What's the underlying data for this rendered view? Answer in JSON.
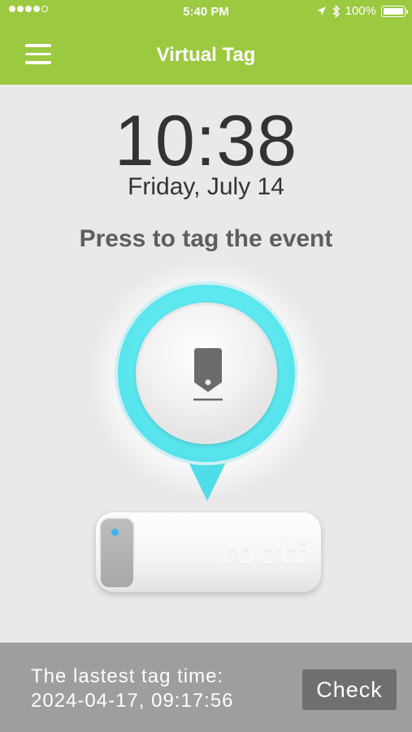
{
  "status_bar": {
    "time": "5:40 PM",
    "battery_percent": "100%",
    "signal_bars_filled": 4,
    "signal_bars_total": 5
  },
  "nav": {
    "title": "Virtual Tag",
    "menu_icon": "hamburger-menu-icon"
  },
  "clock": {
    "time": "10:38",
    "date": "Friday, July 14"
  },
  "main": {
    "prompt": "Press to tag the event",
    "tag_button_icon": "tag-icon",
    "accent_color": "#4fdde7",
    "device_brand": "rootf",
    "device_led_color": "#3fb4f0"
  },
  "footer": {
    "label": "The lastest tag time:",
    "last_tag_time": "2024-04-17, 09:17:56",
    "check_label": "Check"
  },
  "colors": {
    "header": "#9bc93f",
    "background": "#e9e9e9",
    "footer": "#9e9e9e",
    "button": "#6f6f6f"
  }
}
